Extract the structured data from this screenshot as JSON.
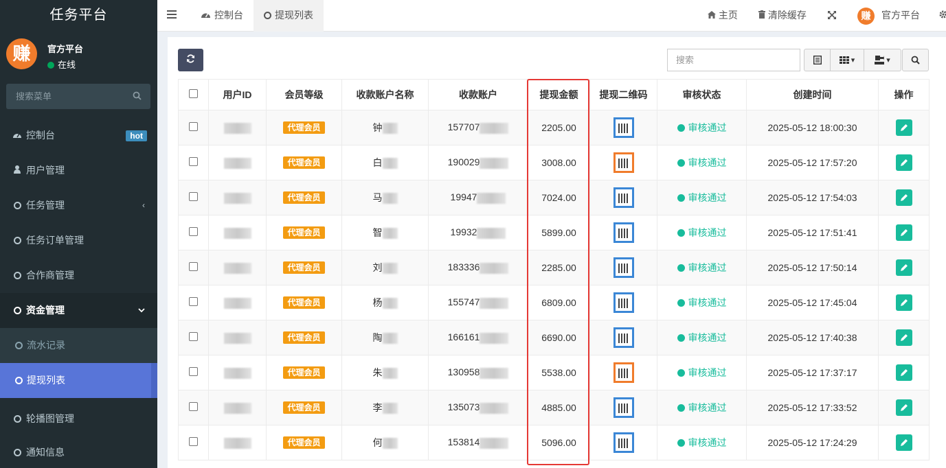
{
  "sidebar": {
    "brand": "任务平台",
    "avatar_char": "赚",
    "user_name": "官方平台",
    "user_status": "在线",
    "search_placeholder": "搜索菜单",
    "items": [
      {
        "label": "控制台",
        "badge": "hot"
      },
      {
        "label": "用户管理"
      },
      {
        "label": "任务管理"
      },
      {
        "label": "任务订单管理"
      },
      {
        "label": "合作商管理"
      },
      {
        "label": "资金管理"
      },
      {
        "label": "轮播图管理"
      },
      {
        "label": "通知信息"
      }
    ],
    "submenu": [
      {
        "label": "流水记录"
      },
      {
        "label": "提现列表"
      }
    ]
  },
  "topbar": {
    "tabs": [
      {
        "label": "控制台"
      },
      {
        "label": "提现列表"
      }
    ],
    "home": "主页",
    "clear_cache": "清除缓存",
    "account": "官方平台"
  },
  "toolbar": {
    "search_placeholder": "搜索"
  },
  "table": {
    "headers": [
      "用户ID",
      "会员等级",
      "收款账户名称",
      "收款账户",
      "提现金额",
      "提现二维码",
      "审核状态",
      "创建时间",
      "操作"
    ],
    "rows": [
      {
        "level": "代理会员",
        "name": "钟",
        "account": "157707",
        "amount": "2205.00",
        "qr": "blue",
        "status": "审核通过",
        "time": "2025-05-12 18:00:30"
      },
      {
        "level": "代理会员",
        "name": "白",
        "account": "190029",
        "amount": "3008.00",
        "qr": "orange",
        "status": "审核通过",
        "time": "2025-05-12 17:57:20"
      },
      {
        "level": "代理会员",
        "name": "马",
        "account": "19947",
        "amount": "7024.00",
        "qr": "blue",
        "status": "审核通过",
        "time": "2025-05-12 17:54:03"
      },
      {
        "level": "代理会员",
        "name": "智",
        "account": "19932",
        "amount": "5899.00",
        "qr": "blue",
        "status": "审核通过",
        "time": "2025-05-12 17:51:41"
      },
      {
        "level": "代理会员",
        "name": "刘",
        "account": "183336",
        "amount": "2285.00",
        "qr": "blue",
        "status": "审核通过",
        "time": "2025-05-12 17:50:14"
      },
      {
        "level": "代理会员",
        "name": "杨",
        "account": "155747",
        "amount": "6809.00",
        "qr": "blue",
        "status": "审核通过",
        "time": "2025-05-12 17:45:04"
      },
      {
        "level": "代理会员",
        "name": "陶",
        "account": "166161",
        "amount": "6690.00",
        "qr": "blue",
        "status": "审核通过",
        "time": "2025-05-12 17:40:38"
      },
      {
        "level": "代理会员",
        "name": "朱",
        "account": "130958",
        "amount": "5538.00",
        "qr": "orange",
        "status": "审核通过",
        "time": "2025-05-12 17:37:17"
      },
      {
        "level": "代理会员",
        "name": "李",
        "account": "135073",
        "amount": "4885.00",
        "qr": "blue",
        "status": "审核通过",
        "time": "2025-05-12 17:33:52"
      },
      {
        "level": "代理会员",
        "name": "何",
        "account": "153814",
        "amount": "5096.00",
        "qr": "blue",
        "status": "审核通过",
        "time": "2025-05-12 17:24:29"
      }
    ]
  },
  "colors": {
    "accent": "#5875d8",
    "status": "#18bc9c",
    "vip": "#f39c12",
    "highlight": "#e53935"
  }
}
